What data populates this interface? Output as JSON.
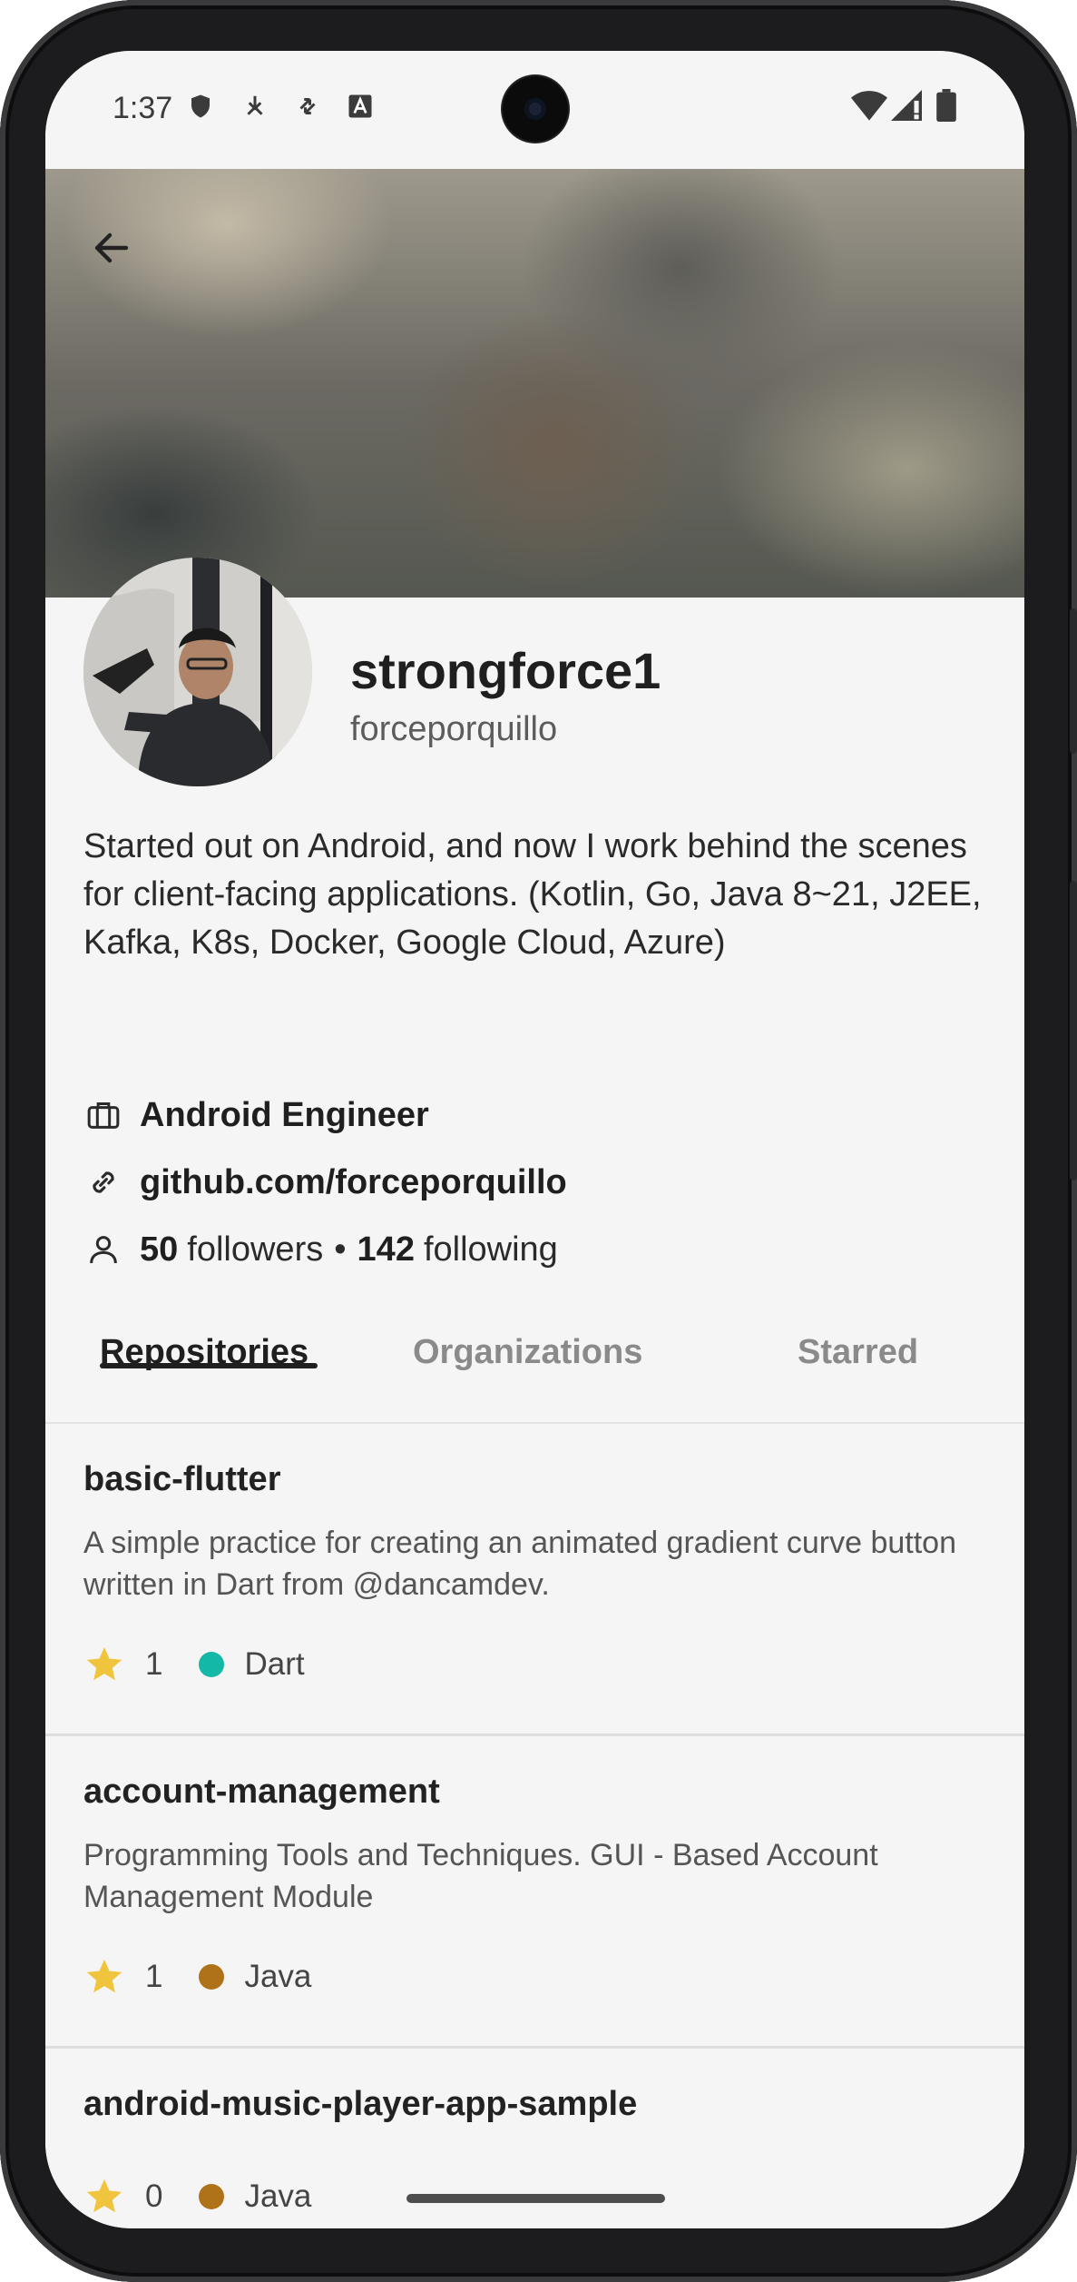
{
  "status_bar": {
    "time": "1:37",
    "icons": [
      "shield-icon",
      "download-icon",
      "sync-icon",
      "font-icon",
      "wifi-icon",
      "signal-icon",
      "battery-icon"
    ]
  },
  "profile": {
    "name": "strongforce1",
    "login": "forceporquillo",
    "bio": "Started out on Android, and now I work behind the scenes for client-facing applications. (Kotlin, Go, Java 8~21, J2EE, Kafka, K8s, Docker, Google Cloud, Azure)",
    "job": "Android Engineer",
    "link": "github.com/forceporquillo",
    "followers_count": "50",
    "followers_label": "followers",
    "separator": "•",
    "following_count": "142",
    "following_label": "following"
  },
  "tabs": [
    {
      "label": "Repositories",
      "active": true
    },
    {
      "label": "Organizations",
      "active": false
    },
    {
      "label": "Starred",
      "active": false
    }
  ],
  "repos": [
    {
      "name": "basic-flutter",
      "description": "A simple practice for creating an animated gradient curve button written in Dart from @dancamdev.",
      "stars": "1",
      "language": "Dart",
      "language_color": "#13b8a6"
    },
    {
      "name": "account-management",
      "description": "Programming Tools and Techniques. GUI - Based Account Management Module",
      "stars": "1",
      "language": "Java",
      "language_color": "#b07219"
    },
    {
      "name": "android-music-player-app-sample",
      "description": "",
      "stars": "0",
      "language": "Java",
      "language_color": "#b07219"
    }
  ],
  "colors": {
    "background": "#f5f5f5",
    "star": "#f0c53d",
    "text_primary": "#1f1f1f",
    "text_secondary": "#555555"
  }
}
